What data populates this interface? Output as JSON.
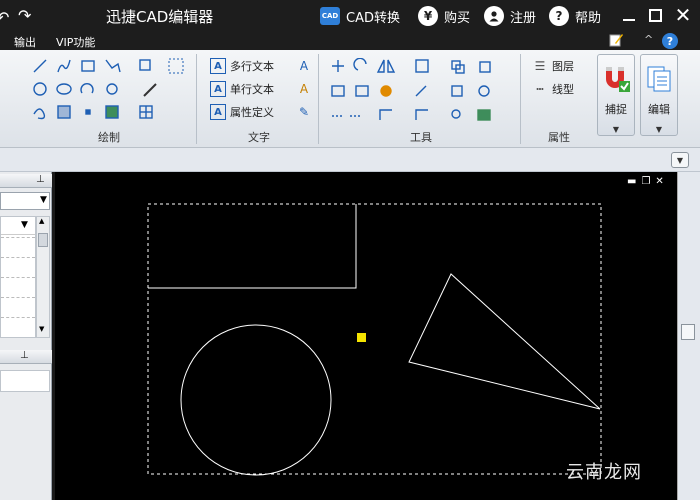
{
  "app": {
    "title": "迅捷CAD编辑器"
  },
  "titlebar": {
    "cad_convert_label": "CAD转换",
    "cad_icon_text": "CAD",
    "buy_label": "购买",
    "buy_icon": "¥",
    "register_label": "注册",
    "help_label": "帮助",
    "help_icon": "?"
  },
  "menubar": {
    "items": [
      "输出",
      "VIP功能"
    ]
  },
  "ribbon": {
    "groups": {
      "draw": "绘制",
      "text": "文字",
      "tools": "工具",
      "properties": "属性"
    },
    "text_items": {
      "multiline": "多行文本",
      "singleline": "单行文本",
      "attribute": "属性定义"
    },
    "property_items": {
      "layer": "图层",
      "linetype": "线型"
    },
    "big_buttons": {
      "snap": "捕捉",
      "edit": "编辑"
    }
  },
  "watermark": {
    "text": "云南龙网"
  },
  "colors": {
    "titlebar_bg": "#1d1d1d",
    "canvas_bg": "#000000",
    "accent_blue": "#2f7fd8",
    "grip_yellow": "#f5e400"
  }
}
